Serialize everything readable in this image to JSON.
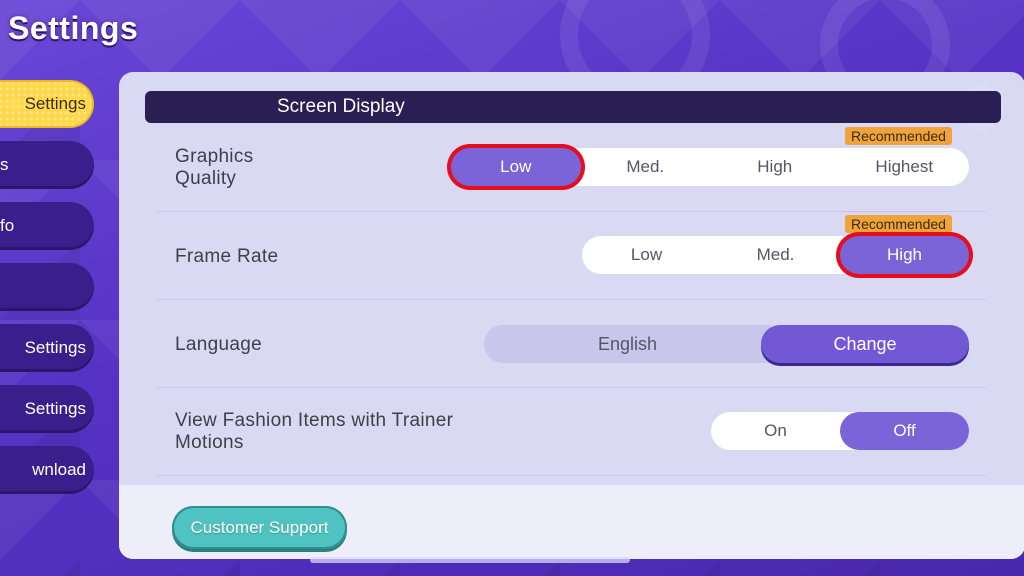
{
  "page": {
    "title": "Settings"
  },
  "sidebar": {
    "items": [
      {
        "label": "Settings",
        "active": true
      },
      {
        "label": "s",
        "active": false
      },
      {
        "label": "fo",
        "active": false
      },
      {
        "label": "",
        "active": false
      },
      {
        "label": "Settings",
        "active": false
      },
      {
        "label": "Settings",
        "active": false
      },
      {
        "label": "wnload",
        "active": false
      }
    ]
  },
  "section": {
    "header": "Screen Display"
  },
  "graphics_quality": {
    "label": "Graphics Quality",
    "recommended": "Recommended",
    "options": [
      "Low",
      "Med.",
      "High",
      "Highest"
    ],
    "selected": "Low"
  },
  "frame_rate": {
    "label": "Frame Rate",
    "recommended": "Recommended",
    "options": [
      "Low",
      "Med.",
      "High"
    ],
    "selected": "High"
  },
  "language": {
    "label": "Language",
    "value": "English",
    "change_label": "Change"
  },
  "fashion_items": {
    "label": "View Fashion Items with Trainer Motions",
    "options": [
      "On",
      "Off"
    ],
    "selected": "Off"
  },
  "footer": {
    "support_label": "Customer Support"
  },
  "colors": {
    "accent": "#7b63d8",
    "highlight_ring": "#e50e1c",
    "recommended_badge": "#f0a33a",
    "support_button": "#4ec3c1",
    "active_tab": "#ffd84a"
  }
}
